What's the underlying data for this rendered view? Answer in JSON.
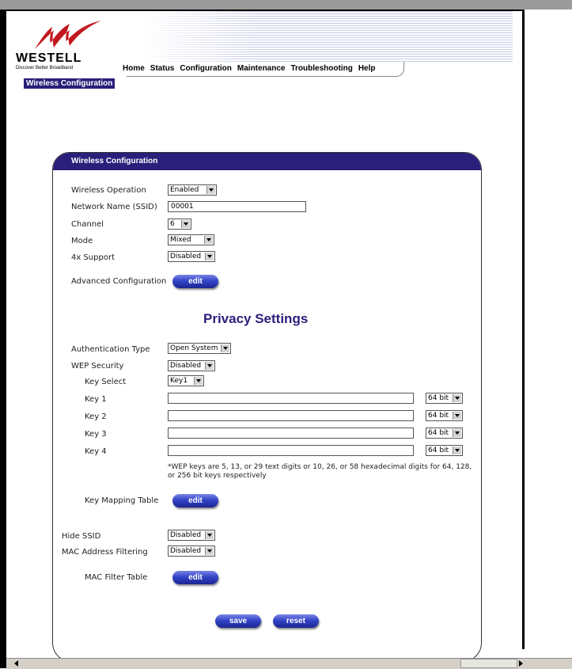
{
  "header": {
    "brand": "WESTELL",
    "tagline": "Discover Better Broadband",
    "nav": [
      "Home",
      "Status",
      "Configuration",
      "Maintenance",
      "Troubleshooting",
      "Help"
    ],
    "breadcrumb": "Wireless Configuration"
  },
  "card": {
    "title": "Wireless Configuration",
    "wireless_operation": {
      "label": "Wireless Operation",
      "value": "Enabled"
    },
    "ssid": {
      "label": "Network Name (SSID)",
      "value": "00001"
    },
    "channel": {
      "label": "Channel",
      "value": "6"
    },
    "mode": {
      "label": "Mode",
      "value": "Mixed"
    },
    "fourx": {
      "label": "4x Support",
      "value": "Disabled"
    },
    "advanced": {
      "label": "Advanced Configuration",
      "button": "edit"
    },
    "privacy_title": "Privacy Settings",
    "auth_type": {
      "label": "Authentication Type",
      "value": "Open System"
    },
    "wep_security": {
      "label": "WEP Security",
      "value": "Disabled"
    },
    "key_select": {
      "label": "Key Select",
      "value": "Key1"
    },
    "keys": [
      {
        "label": "Key 1",
        "value": "",
        "bits": "64 bit"
      },
      {
        "label": "Key 2",
        "value": "",
        "bits": "64 bit"
      },
      {
        "label": "Key 3",
        "value": "",
        "bits": "64 bit"
      },
      {
        "label": "Key 4",
        "value": "",
        "bits": "64 bit"
      }
    ],
    "wep_note": "*WEP keys are 5, 13, or 29 text digits or 10, 26, or 58 hexadecimal digits for 64, 128, or 256 bit keys respectively",
    "key_mapping": {
      "label": "Key Mapping Table",
      "button": "edit"
    },
    "hide_ssid": {
      "label": "Hide SSID",
      "value": "Disabled"
    },
    "mac_filtering": {
      "label": "MAC Address Filtering",
      "value": "Disabled"
    },
    "mac_table": {
      "label": "MAC Filter Table",
      "button": "edit"
    },
    "save": "save",
    "reset": "reset"
  },
  "colors": {
    "accent": "#2a1f7a",
    "button": "#3344c8"
  }
}
